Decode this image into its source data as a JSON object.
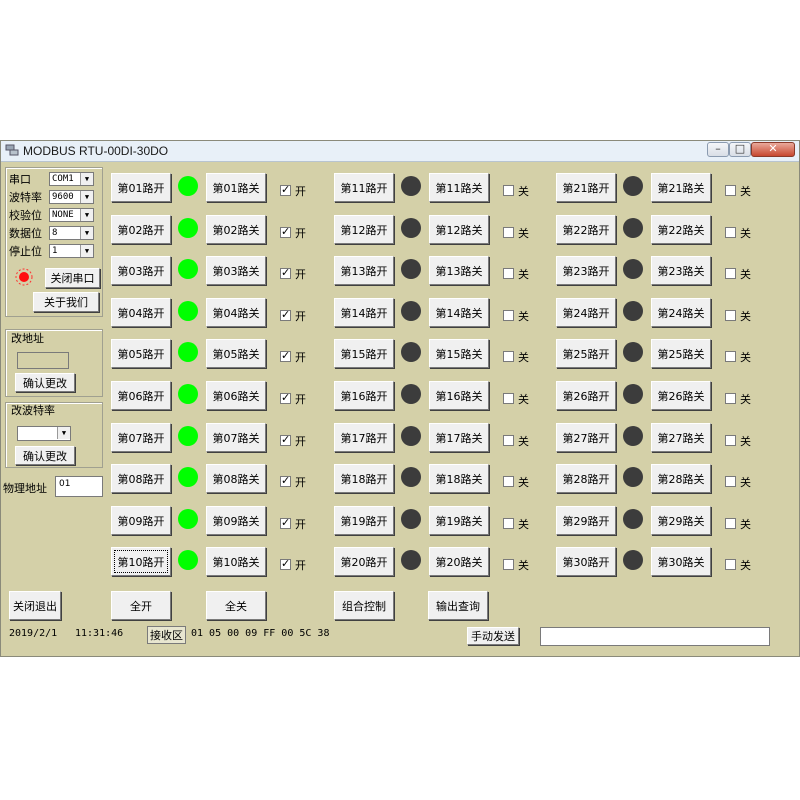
{
  "window": {
    "title": "MODBUS RTU-00DI-30DO"
  },
  "serial": {
    "port_label": "串口",
    "port_value": "COM1",
    "baud_label": "波特率",
    "baud_value": "9600",
    "parity_label": "校验位",
    "parity_value": "NONE",
    "databits_label": "数据位",
    "databits_value": "8",
    "stopbits_label": "停止位",
    "stopbits_value": "1",
    "close_port_label": "关闭串口",
    "about_label": "关于我们"
  },
  "address_group": {
    "title": "改地址",
    "confirm_label": "确认更改"
  },
  "baud_group": {
    "title": "改波特率",
    "confirm_label": "确认更改"
  },
  "physical_address": {
    "label": "物理地址",
    "value": "01"
  },
  "columns": [
    {
      "channels": [
        {
          "open": "第01路开",
          "close": "第01路关",
          "led": "on",
          "check": true,
          "check_label": "开"
        },
        {
          "open": "第02路开",
          "close": "第02路关",
          "led": "on",
          "check": true,
          "check_label": "开"
        },
        {
          "open": "第03路开",
          "close": "第03路关",
          "led": "on",
          "check": true,
          "check_label": "开"
        },
        {
          "open": "第04路开",
          "close": "第04路关",
          "led": "on",
          "check": true,
          "check_label": "开"
        },
        {
          "open": "第05路开",
          "close": "第05路关",
          "led": "on",
          "check": true,
          "check_label": "开"
        },
        {
          "open": "第06路开",
          "close": "第06路关",
          "led": "on",
          "check": true,
          "check_label": "开"
        },
        {
          "open": "第07路开",
          "close": "第07路关",
          "led": "on",
          "check": true,
          "check_label": "开"
        },
        {
          "open": "第08路开",
          "close": "第08路关",
          "led": "on",
          "check": true,
          "check_label": "开"
        },
        {
          "open": "第09路开",
          "close": "第09路关",
          "led": "on",
          "check": true,
          "check_label": "开"
        },
        {
          "open": "第10路开",
          "close": "第10路关",
          "led": "on",
          "check": true,
          "check_label": "开"
        }
      ]
    },
    {
      "channels": [
        {
          "open": "第11路开",
          "close": "第11路关",
          "led": "off",
          "check": false,
          "check_label": "关"
        },
        {
          "open": "第12路开",
          "close": "第12路关",
          "led": "off",
          "check": false,
          "check_label": "关"
        },
        {
          "open": "第13路开",
          "close": "第13路关",
          "led": "off",
          "check": false,
          "check_label": "关"
        },
        {
          "open": "第14路开",
          "close": "第14路关",
          "led": "off",
          "check": false,
          "check_label": "关"
        },
        {
          "open": "第15路开",
          "close": "第15路关",
          "led": "off",
          "check": false,
          "check_label": "关"
        },
        {
          "open": "第16路开",
          "close": "第16路关",
          "led": "off",
          "check": false,
          "check_label": "关"
        },
        {
          "open": "第17路开",
          "close": "第17路关",
          "led": "off",
          "check": false,
          "check_label": "关"
        },
        {
          "open": "第18路开",
          "close": "第18路关",
          "led": "off",
          "check": false,
          "check_label": "关"
        },
        {
          "open": "第19路开",
          "close": "第19路关",
          "led": "off",
          "check": false,
          "check_label": "关"
        },
        {
          "open": "第20路开",
          "close": "第20路关",
          "led": "off",
          "check": false,
          "check_label": "关"
        }
      ]
    },
    {
      "channels": [
        {
          "open": "第21路开",
          "close": "第21路关",
          "led": "off",
          "check": false,
          "check_label": "关"
        },
        {
          "open": "第22路开",
          "close": "第22路关",
          "led": "off",
          "check": false,
          "check_label": "关"
        },
        {
          "open": "第23路开",
          "close": "第23路关",
          "led": "off",
          "check": false,
          "check_label": "关"
        },
        {
          "open": "第24路开",
          "close": "第24路关",
          "led": "off",
          "check": false,
          "check_label": "关"
        },
        {
          "open": "第25路开",
          "close": "第25路关",
          "led": "off",
          "check": false,
          "check_label": "关"
        },
        {
          "open": "第26路开",
          "close": "第26路关",
          "led": "off",
          "check": false,
          "check_label": "关"
        },
        {
          "open": "第27路开",
          "close": "第27路关",
          "led": "off",
          "check": false,
          "check_label": "关"
        },
        {
          "open": "第28路开",
          "close": "第28路关",
          "led": "off",
          "check": false,
          "check_label": "关"
        },
        {
          "open": "第29路开",
          "close": "第29路关",
          "led": "off",
          "check": false,
          "check_label": "关"
        },
        {
          "open": "第30路开",
          "close": "第30路关",
          "led": "off",
          "check": false,
          "check_label": "关"
        }
      ]
    }
  ],
  "bottom": {
    "exit_label": "关闭退出",
    "all_on_label": "全开",
    "all_off_label": "全关",
    "combo_label": "组合控制",
    "query_label": "输出查询"
  },
  "status": {
    "date": "2019/2/1",
    "time": "11:31:46",
    "recv_label": "接收区",
    "recv_data": "01 05 00 09 FF 00 5C 38",
    "send_label": "手动发送",
    "send_value": ""
  },
  "colors": {
    "led_on": "#00ff00",
    "led_off": "#3c3c3c",
    "background": "#d4d0a8"
  }
}
